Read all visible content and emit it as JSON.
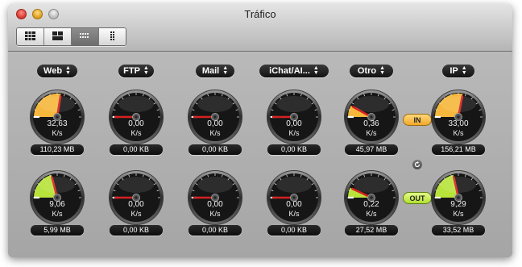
{
  "window": {
    "title": "Tráfico"
  },
  "toolbar": {
    "buttons": [
      {
        "icon": "view-grid-icon",
        "active": false
      },
      {
        "icon": "view-split-icon",
        "active": false
      },
      {
        "icon": "view-dots-icon",
        "active": true
      },
      {
        "icon": "view-columns-icon",
        "active": false
      }
    ]
  },
  "colors": {
    "in": "#f5b73c",
    "out": "#b8e33a"
  },
  "columns": [
    {
      "id": "web",
      "label": "Web",
      "in": {
        "value": "32,63",
        "unit": "K/s",
        "total": "110,23 MB",
        "level": 0.55
      },
      "out": {
        "value": "9,06",
        "unit": "K/s",
        "total": "5,99 MB",
        "level": 0.42
      }
    },
    {
      "id": "ftp",
      "label": "FTP",
      "in": {
        "value": "0,00",
        "unit": "K/s",
        "total": "0,00 KB",
        "level": 0
      },
      "out": {
        "value": "0,00",
        "unit": "K/s",
        "total": "0,00 KB",
        "level": 0
      }
    },
    {
      "id": "mail",
      "label": "Mail",
      "in": {
        "value": "0,00",
        "unit": "K/s",
        "total": "0,00 KB",
        "level": 0
      },
      "out": {
        "value": "0,00",
        "unit": "K/s",
        "total": "0,00 KB",
        "level": 0
      }
    },
    {
      "id": "ichat",
      "label": "iChat/AI...",
      "in": {
        "value": "0,00",
        "unit": "K/s",
        "total": "0,00 KB",
        "level": 0
      },
      "out": {
        "value": "0,00",
        "unit": "K/s",
        "total": "0,00 KB",
        "level": 0
      }
    },
    {
      "id": "otro",
      "label": "Otro",
      "in": {
        "value": "0,36",
        "unit": "K/s",
        "total": "45,97 MB",
        "level": 0.16
      },
      "out": {
        "value": "0,22",
        "unit": "K/s",
        "total": "27,52 MB",
        "level": 0.14
      }
    },
    {
      "id": "ip",
      "label": "IP",
      "in": {
        "value": "33,00",
        "unit": "K/s",
        "total": "156,21 MB",
        "level": 0.56
      },
      "out": {
        "value": "9,29",
        "unit": "K/s",
        "total": "33,52 MB",
        "level": 0.43
      }
    }
  ],
  "legend": {
    "in_label": "IN",
    "out_label": "OUT",
    "reset_icon": "refresh-icon"
  }
}
